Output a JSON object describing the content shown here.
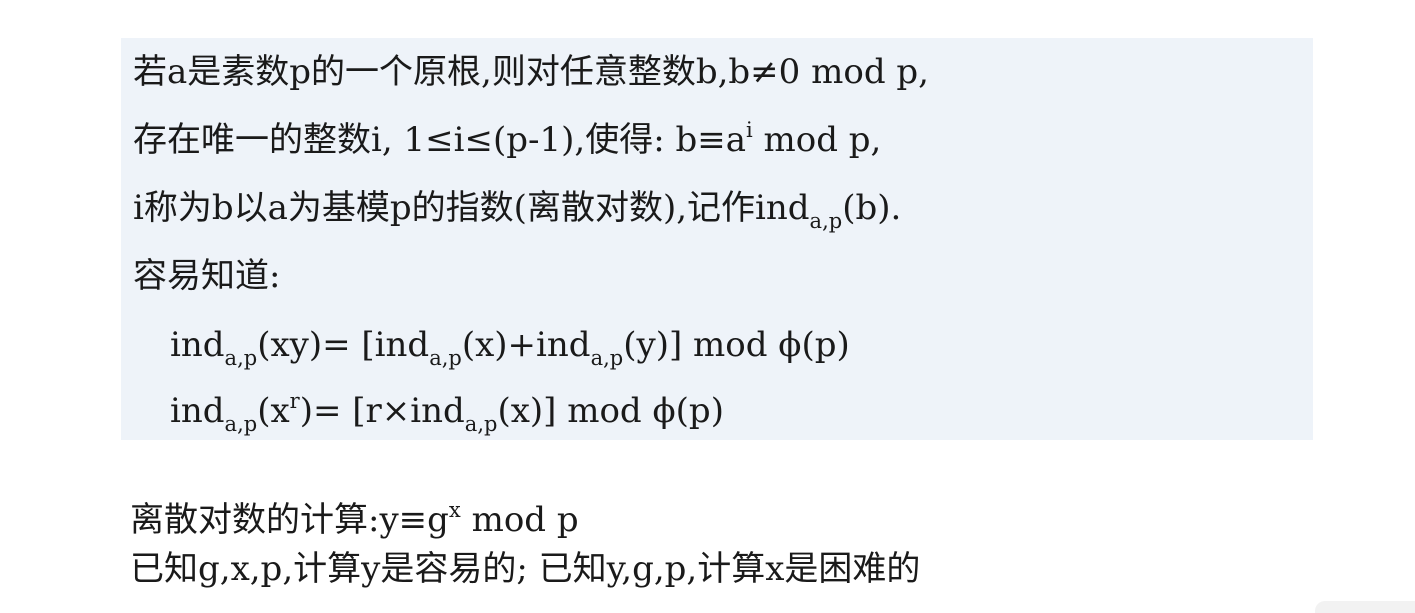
{
  "panel": {
    "line1": "若a是素数p的一个原根,则对任意整数b,b≠0 mod p,",
    "line2_main": "存在唯一的整数i, 1≤i≤(p-1),使得: b≡a",
    "line2_sup": "i",
    "line2_tail": " mod p,",
    "line3_main": "i称为b以a为基模p的指数(离散对数),记作ind",
    "line3_sub": "a,p",
    "line3_tail": "(b).",
    "line4": "容易知道:",
    "formula1": {
      "t1": "ind",
      "s1": "a,p",
      "t2": "(xy)= [ind",
      "s2": "a,p",
      "t3": "(x)+ind",
      "s3": "a,p",
      "t4": "(y)]  mod ϕ(p)"
    },
    "formula2": {
      "t1": "ind",
      "s1": "a,p",
      "t2": "(x",
      "sup": "r",
      "t3": ")= [r×ind",
      "s2": "a,p",
      "t4": "(x)]  mod ϕ(p)"
    }
  },
  "footer": {
    "line1_main": "离散对数的计算:y≡g",
    "line1_sup": "x",
    "line1_tail": " mod p",
    "line2": "已知g,x,p,计算y是容易的; 已知y,g,p,计算x是困难的"
  }
}
